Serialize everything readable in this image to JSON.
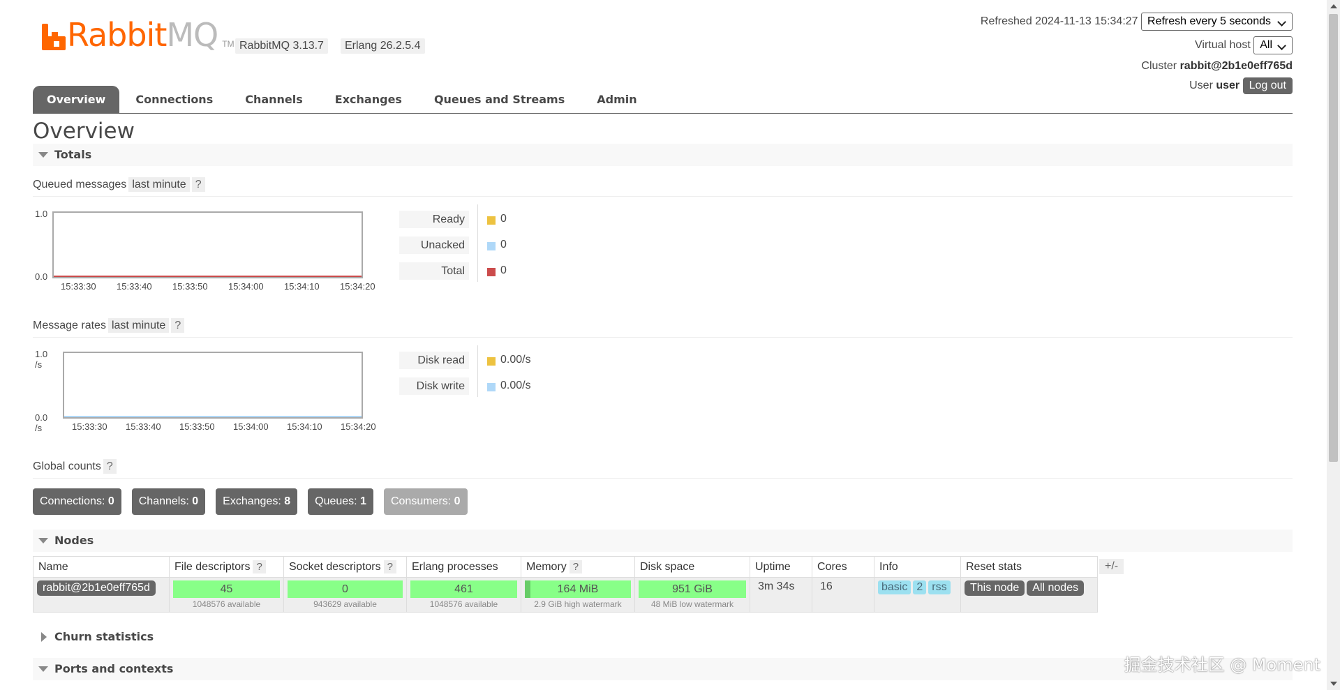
{
  "brand": {
    "logo_left": "Rabbit",
    "logo_right": "MQ",
    "tm": "TM",
    "color": "#ff6600"
  },
  "versions": {
    "rabbitmq": "RabbitMQ 3.13.7",
    "erlang": "Erlang 26.2.5.4"
  },
  "header": {
    "refreshed_label": "Refreshed 2024-11-13 15:34:27",
    "refresh_select": "Refresh every 5 seconds",
    "vhost_label": "Virtual host",
    "vhost_select": "All",
    "cluster_label": "Cluster",
    "cluster_name": "rabbit@2b1e0eff765d",
    "user_label": "User",
    "user_name": "user",
    "logout": "Log out"
  },
  "tabs": [
    "Overview",
    "Connections",
    "Channels",
    "Exchanges",
    "Queues and Streams",
    "Admin"
  ],
  "page_title": "Overview",
  "sections": {
    "totals": "Totals",
    "nodes": "Nodes",
    "churn": "Churn statistics",
    "ports": "Ports and contexts"
  },
  "queued": {
    "label": "Queued messages",
    "range": "last minute",
    "help": "?",
    "legend": [
      {
        "name": "Ready",
        "value": "0",
        "color": "#edc240"
      },
      {
        "name": "Unacked",
        "value": "0",
        "color": "#afd8f8"
      },
      {
        "name": "Total",
        "value": "0",
        "color": "#cb4b4b"
      }
    ]
  },
  "rates": {
    "label": "Message rates",
    "range": "last minute",
    "help": "?",
    "legend": [
      {
        "name": "Disk read",
        "value": "0.00/s",
        "color": "#edc240"
      },
      {
        "name": "Disk write",
        "value": "0.00/s",
        "color": "#afd8f8"
      }
    ]
  },
  "chart_data": [
    {
      "type": "line",
      "title": "Queued messages",
      "x": [
        "15:33:30",
        "15:33:40",
        "15:33:50",
        "15:34:00",
        "15:34:10",
        "15:34:20"
      ],
      "ylim": [
        0,
        1
      ],
      "yticks": [
        "0.0",
        "1.0"
      ],
      "series": [
        {
          "name": "Ready",
          "values": [
            0,
            0,
            0,
            0,
            0,
            0
          ]
        },
        {
          "name": "Unacked",
          "values": [
            0,
            0,
            0,
            0,
            0,
            0
          ]
        },
        {
          "name": "Total",
          "values": [
            0,
            0,
            0,
            0,
            0,
            0
          ]
        }
      ]
    },
    {
      "type": "line",
      "title": "Message rates",
      "x": [
        "15:33:30",
        "15:33:40",
        "15:33:50",
        "15:34:00",
        "15:34:10",
        "15:34:20"
      ],
      "ylim": [
        0,
        1
      ],
      "yticks": [
        "0.0 /s",
        "1.0 /s"
      ],
      "series": [
        {
          "name": "Disk read",
          "values": [
            0,
            0,
            0,
            0,
            0,
            0
          ]
        },
        {
          "name": "Disk write",
          "values": [
            0,
            0,
            0,
            0,
            0,
            0
          ]
        }
      ]
    }
  ],
  "global_counts": {
    "label": "Global counts",
    "help": "?",
    "items": [
      {
        "label": "Connections:",
        "value": "0"
      },
      {
        "label": "Channels:",
        "value": "0"
      },
      {
        "label": "Exchanges:",
        "value": "8"
      },
      {
        "label": "Queues:",
        "value": "1"
      },
      {
        "label": "Consumers:",
        "value": "0"
      }
    ]
  },
  "nodes_table": {
    "headers": [
      "Name",
      "File descriptors",
      "Socket descriptors",
      "Erlang processes",
      "Memory",
      "Disk space",
      "Uptime",
      "Cores",
      "Info",
      "Reset stats"
    ],
    "help": "?",
    "plus_minus": "+/-",
    "row": {
      "name": "rabbit@2b1e0eff765d",
      "fd": "45",
      "fd_sub": "1048576 available",
      "sd": "0",
      "sd_sub": "943629 available",
      "ep": "461",
      "ep_sub": "1048576 available",
      "mem": "164 MiB",
      "mem_sub": "2.9 GiB high watermark",
      "disk": "951 GiB",
      "disk_sub": "48 MiB low watermark",
      "uptime": "3m 34s",
      "cores": "16",
      "info": [
        "basic",
        "2",
        "rss"
      ],
      "reset": [
        "This node",
        "All nodes"
      ]
    }
  },
  "watermark": "掘金技术社区 @ Moment"
}
